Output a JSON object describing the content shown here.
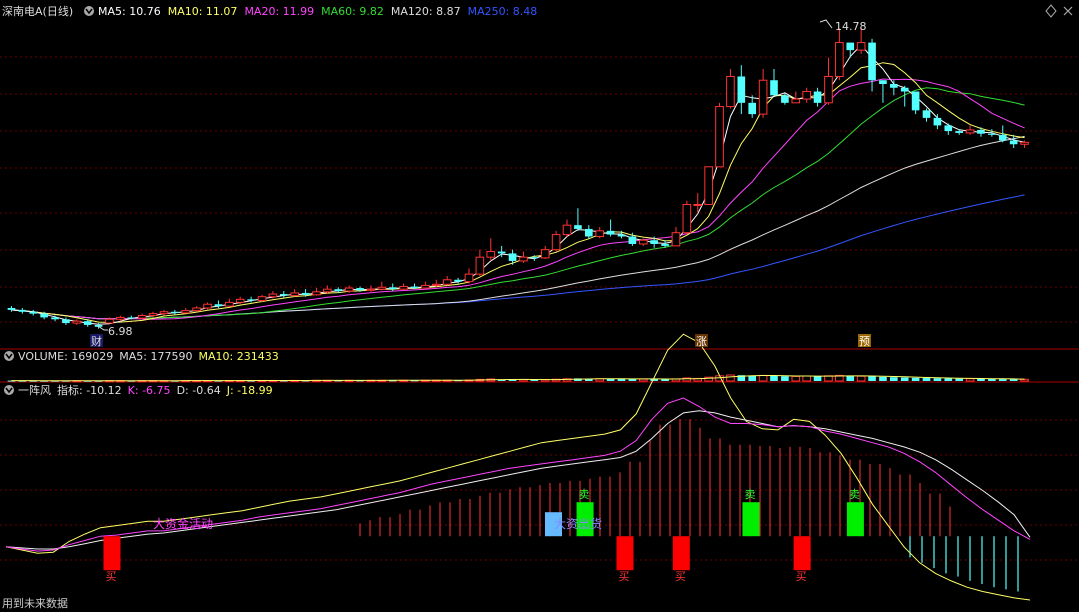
{
  "header": {
    "stock_name": "深南电A(日线)",
    "ma_labels": [
      {
        "text": "MA5: 10.76",
        "color": "#ffffff"
      },
      {
        "text": "MA10: 11.07",
        "color": "#ffff66"
      },
      {
        "text": "MA20: 11.99",
        "color": "#ff44ff"
      },
      {
        "text": "MA60: 9.82",
        "color": "#33dd33"
      },
      {
        "text": "MA120: 8.87",
        "color": "#dddddd"
      },
      {
        "text": "MA250: 8.48",
        "color": "#3355ff"
      }
    ]
  },
  "volume_header": {
    "labels": [
      {
        "text": "VOLUME: 169029",
        "color": "#dddddd"
      },
      {
        "text": "MA5: 177590",
        "color": "#dddddd"
      },
      {
        "text": "MA10: 231433",
        "color": "#ffff66"
      }
    ]
  },
  "indicator_header": {
    "labels": [
      {
        "text": "一阵风",
        "color": "#dddddd"
      },
      {
        "text": "指标: -10.12",
        "color": "#dddddd"
      },
      {
        "text": "K: -6.75",
        "color": "#ff44ff"
      },
      {
        "text": "D: -0.64",
        "color": "#dddddd"
      },
      {
        "text": "J: -18.99",
        "color": "#ffff66"
      }
    ]
  },
  "annotations": {
    "high_label": "14.78",
    "low_label": "6.98",
    "marker_cai": "财",
    "marker_zhang": "涨",
    "marker_yu": "预",
    "da_zi_jin": "大资金活动",
    "da_zi_chu_huo": "大资出货",
    "mai_sell": "卖",
    "mai_buy": "买",
    "footer_note": "用到未来数据"
  },
  "colors": {
    "up": "#ff3333",
    "down": "#54ffff",
    "grid": "#6b0000",
    "ma5": "#ffffff",
    "ma10": "#ffff66",
    "ma20": "#ff44ff",
    "ma60": "#33dd33",
    "ma120": "#dddddd",
    "ma250": "#3355ff"
  },
  "chart_data": [
    {
      "type": "candlestick",
      "candles": [
        [
          7.35,
          7.3,
          7.4,
          7.25
        ],
        [
          7.3,
          7.25,
          7.35,
          7.2
        ],
        [
          7.25,
          7.2,
          7.3,
          7.15
        ],
        [
          7.2,
          7.1,
          7.25,
          7.05
        ],
        [
          7.1,
          7.05,
          7.15,
          7.0
        ],
        [
          7.05,
          6.95,
          7.1,
          6.9
        ],
        [
          6.95,
          7.0,
          7.05,
          6.9
        ],
        [
          7.0,
          6.9,
          7.05,
          6.85
        ],
        [
          6.9,
          6.85,
          6.95,
          6.8
        ],
        [
          6.95,
          7.05,
          7.1,
          6.98
        ],
        [
          7.05,
          7.1,
          7.15,
          7.0
        ],
        [
          7.1,
          7.08,
          7.15,
          7.05
        ],
        [
          7.08,
          7.15,
          7.2,
          7.05
        ],
        [
          7.15,
          7.2,
          7.25,
          7.1
        ],
        [
          7.2,
          7.25,
          7.3,
          7.15
        ],
        [
          7.25,
          7.22,
          7.3,
          7.18
        ],
        [
          7.22,
          7.28,
          7.35,
          7.2
        ],
        [
          7.28,
          7.35,
          7.4,
          7.25
        ],
        [
          7.35,
          7.45,
          7.5,
          7.3
        ],
        [
          7.45,
          7.4,
          7.55,
          7.35
        ],
        [
          7.4,
          7.5,
          7.6,
          7.38
        ],
        [
          7.5,
          7.58,
          7.65,
          7.45
        ],
        [
          7.58,
          7.55,
          7.65,
          7.5
        ],
        [
          7.55,
          7.65,
          7.7,
          7.5
        ],
        [
          7.65,
          7.72,
          7.8,
          7.6
        ],
        [
          7.72,
          7.68,
          7.8,
          7.62
        ],
        [
          7.68,
          7.75,
          7.85,
          7.65
        ],
        [
          7.75,
          7.7,
          7.85,
          7.65
        ],
        [
          7.7,
          7.78,
          7.88,
          7.68
        ],
        [
          7.78,
          7.85,
          7.95,
          7.72
        ],
        [
          7.85,
          7.8,
          7.9,
          7.75
        ],
        [
          7.8,
          7.88,
          7.95,
          7.75
        ],
        [
          7.88,
          7.82,
          7.92,
          7.78
        ],
        [
          7.82,
          7.85,
          7.95,
          7.78
        ],
        [
          7.85,
          7.9,
          8.05,
          7.82
        ],
        [
          7.9,
          7.85,
          8.0,
          7.8
        ],
        [
          7.85,
          7.92,
          8.0,
          7.82
        ],
        [
          7.92,
          7.88,
          8.0,
          7.85
        ],
        [
          7.88,
          7.95,
          8.05,
          7.85
        ],
        [
          7.95,
          7.98,
          8.1,
          7.9
        ],
        [
          7.98,
          8.1,
          8.2,
          7.95
        ],
        [
          8.1,
          8.05,
          8.15,
          8.0
        ],
        [
          8.05,
          8.25,
          8.4,
          8.0
        ],
        [
          8.25,
          8.7,
          8.9,
          8.2
        ],
        [
          8.7,
          8.85,
          9.2,
          8.6
        ],
        [
          8.85,
          8.8,
          9.0,
          8.7
        ],
        [
          8.8,
          8.6,
          8.9,
          8.5
        ],
        [
          8.6,
          8.7,
          8.85,
          8.55
        ],
        [
          8.7,
          8.68,
          8.75,
          8.6
        ],
        [
          8.68,
          8.9,
          9.0,
          8.65
        ],
        [
          8.9,
          9.3,
          9.4,
          8.85
        ],
        [
          9.3,
          9.55,
          9.7,
          9.25
        ],
        [
          9.55,
          9.45,
          10.0,
          9.4
        ],
        [
          9.45,
          9.25,
          9.55,
          9.2
        ],
        [
          9.25,
          9.4,
          9.5,
          9.2
        ],
        [
          9.4,
          9.3,
          9.7,
          9.25
        ],
        [
          9.3,
          9.25,
          9.4,
          9.2
        ],
        [
          9.25,
          9.05,
          9.35,
          9.0
        ],
        [
          9.05,
          9.15,
          9.2,
          9.0
        ],
        [
          9.15,
          9.05,
          9.25,
          8.95
        ],
        [
          9.05,
          9.0,
          9.15,
          8.95
        ],
        [
          9.0,
          9.35,
          9.5,
          9.0
        ],
        [
          9.35,
          10.1,
          10.2,
          9.3
        ],
        [
          10.1,
          10.1,
          10.4,
          9.9
        ],
        [
          10.1,
          11.1,
          11.1,
          10.1
        ],
        [
          11.1,
          12.7,
          12.8,
          11.1
        ],
        [
          12.7,
          13.5,
          13.7,
          12.65
        ],
        [
          13.5,
          12.8,
          13.8,
          12.5
        ],
        [
          12.8,
          12.5,
          13.0,
          12.4
        ],
        [
          12.5,
          13.4,
          13.7,
          12.4
        ],
        [
          13.4,
          13.0,
          13.7,
          13.0
        ],
        [
          13.0,
          12.8,
          13.05,
          12.75
        ],
        [
          12.8,
          12.9,
          13.1,
          12.8
        ],
        [
          12.9,
          13.1,
          13.2,
          12.8
        ],
        [
          13.1,
          12.8,
          13.2,
          12.7
        ],
        [
          12.8,
          13.5,
          14.0,
          12.75
        ],
        [
          13.5,
          14.4,
          14.78,
          13.4
        ],
        [
          14.4,
          14.2,
          14.3,
          14.0
        ],
        [
          14.2,
          14.4,
          14.8,
          14.1
        ],
        [
          14.4,
          13.4,
          14.5,
          13.1
        ],
        [
          13.4,
          13.3,
          13.4,
          12.8
        ],
        [
          13.3,
          13.2,
          13.4,
          13.0
        ],
        [
          13.2,
          13.1,
          13.25,
          12.7
        ],
        [
          13.1,
          12.6,
          13.1,
          12.5
        ],
        [
          12.6,
          12.4,
          12.65,
          12.3
        ],
        [
          12.4,
          12.2,
          12.5,
          12.1
        ],
        [
          12.2,
          12.05,
          12.25,
          11.95
        ],
        [
          12.05,
          12.0,
          12.1,
          11.95
        ],
        [
          12.0,
          12.08,
          12.2,
          11.95
        ],
        [
          12.08,
          11.98,
          12.15,
          11.9
        ],
        [
          11.98,
          11.95,
          12.1,
          11.9
        ],
        [
          11.95,
          11.8,
          12.2,
          11.75
        ],
        [
          11.8,
          11.7,
          11.95,
          11.6
        ],
        [
          11.7,
          11.75,
          11.8,
          11.6
        ]
      ],
      "y_range": [
        6.5,
        15.0
      ]
    },
    {
      "type": "bar",
      "name": "volume",
      "y_range": [
        0,
        1600000
      ],
      "values": [
        40000,
        35000,
        30000,
        32000,
        30000,
        35000,
        30000,
        28000,
        26000,
        38000,
        30000,
        32000,
        35000,
        36000,
        34000,
        35000,
        38000,
        40000,
        45000,
        42000,
        48000,
        50000,
        45000,
        52000,
        55000,
        50000,
        58000,
        55000,
        60000,
        62000,
        60000,
        65000,
        62000,
        68000,
        70000,
        65000,
        72000,
        68000,
        75000,
        80000,
        85000,
        78000,
        100000,
        160000,
        200000,
        150000,
        130000,
        140000,
        120000,
        150000,
        180000,
        220000,
        260000,
        200000,
        220000,
        240000,
        210000,
        200000,
        190000,
        200000,
        180000,
        210000,
        300000,
        260000,
        380000,
        520000,
        600000,
        580000,
        500000,
        560000,
        520000,
        480000,
        460000,
        500000,
        480000,
        520000,
        560000,
        500000,
        480000,
        460000,
        420000,
        380000,
        350000,
        320000,
        300000,
        280000,
        260000,
        240000,
        230000,
        220000,
        200000,
        190000,
        185000,
        170000
      ]
    },
    {
      "type": "indicator",
      "name": "一阵风",
      "y_range": [
        -60,
        130
      ],
      "k": [
        -10,
        -12,
        -14,
        -13,
        -8,
        -4,
        0,
        1,
        3,
        5,
        5,
        7,
        9,
        11,
        13,
        15,
        18,
        20,
        22,
        24,
        26,
        29,
        32,
        35,
        38,
        41,
        45,
        49,
        52,
        55,
        58,
        61,
        64,
        66,
        68,
        70,
        72,
        74,
        76,
        80,
        90,
        110,
        125,
        130,
        122,
        112,
        106,
        106,
        105,
        103,
        104,
        103,
        99,
        96,
        92,
        88,
        84,
        78,
        70,
        60,
        48,
        36,
        25,
        15,
        5,
        -3
      ],
      "d": [
        -10,
        -11,
        -12,
        -12,
        -10,
        -7,
        -4,
        -2,
        0,
        2,
        3,
        5,
        7,
        9,
        11,
        13,
        15,
        17,
        19,
        21,
        23,
        25,
        28,
        31,
        34,
        37,
        40,
        43,
        46,
        49,
        52,
        55,
        58,
        61,
        64,
        66,
        68,
        70,
        72,
        74,
        80,
        92,
        106,
        116,
        118,
        116,
        112,
        109,
        106,
        103,
        104,
        103,
        101,
        98,
        95,
        92,
        88,
        84,
        79,
        72,
        63,
        53,
        43,
        32,
        20,
        -1
      ],
      "j": [
        -10,
        -13,
        -16,
        -15,
        -5,
        2,
        8,
        10,
        12,
        14,
        14,
        16,
        18,
        20,
        22,
        24,
        27,
        30,
        33,
        35,
        37,
        40,
        43,
        46,
        49,
        52,
        56,
        60,
        64,
        68,
        72,
        76,
        80,
        84,
        88,
        90,
        92,
        94,
        96,
        100,
        115,
        145,
        175,
        190,
        182,
        160,
        130,
        108,
        101,
        100,
        110,
        108,
        95,
        78,
        55,
        30,
        10,
        -10,
        -25,
        -35,
        -42,
        -48,
        -52,
        -55,
        -58,
        -60
      ],
      "ind_x": [
        0.05,
        0.115,
        0.53,
        0.58,
        0.66,
        0.695,
        0.735,
        0.78,
        0.845,
        0.9,
        0.955
      ],
      "markers_sell_x": [
        0.103,
        0.604,
        0.659,
        0.777
      ],
      "markers_buy_x": [
        0.565,
        0.727,
        0.829
      ],
      "ind_fall_values": [
        -20,
        -25,
        -30,
        -35,
        -38,
        -42,
        -45,
        -48,
        -50,
        -52
      ]
    }
  ]
}
